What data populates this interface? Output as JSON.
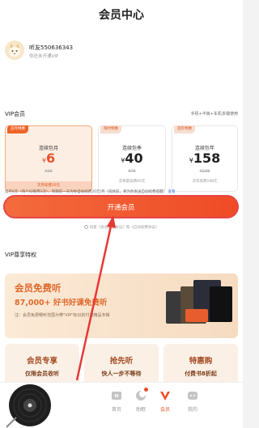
{
  "header": {
    "title": "会员中心"
  },
  "profile": {
    "username": "听友550636343",
    "status": "你还未开通VIP",
    "avatar_icon": "cat-avatar"
  },
  "vip": {
    "title": "VIP会员",
    "right_text": "手机+平板+车机多端使用",
    "cards": [
      {
        "tag": "首月特惠",
        "name": "连续包月",
        "yen": "¥",
        "price": "6",
        "original": "¥25",
        "note": "次月续费20元"
      },
      {
        "tag": "限时特惠",
        "name": "连续包季",
        "yen": "¥",
        "price": "40",
        "original": "¥75",
        "note": "次季度续费60元"
      },
      {
        "tag": "首年特惠",
        "name": "连续包年",
        "yen": "¥",
        "price": "158",
        "original": "¥238",
        "note": "次年续费198元"
      }
    ],
    "description": "首月6元（每个ID限用1次），到期前一天为你自动续费20元/月（扣款前，将为你发送自动续费提醒）",
    "description_link": "查看",
    "open_button": "开通会员",
    "agreement_prefix": "同意",
    "agreement_link1": "《会员服务协议》",
    "agreement_and": "和",
    "agreement_link2": "《自动续费协议》"
  },
  "privileges": {
    "title": "VIP尊享特权",
    "banner": {
      "title": "会员免费听",
      "subtitle": "87,000+ 好书好课免费听",
      "note": "注：会员免费畅听范围为带\"VIP\"标识的付费精品专辑"
    },
    "features": [
      {
        "title": "会员专享",
        "sub": "仅限会员收听"
      },
      {
        "title": "抢先听",
        "sub": "快人一步不等待"
      },
      {
        "title": "特惠购",
        "sub": "付费书8折起"
      }
    ]
  },
  "tabbar": {
    "items": [
      {
        "label": "首页",
        "icon": "home-icon",
        "active": false
      },
      {
        "label": "助眠",
        "icon": "sleep-icon",
        "active": false
      },
      {
        "label": "会员",
        "icon": "vip-icon",
        "active": true
      },
      {
        "label": "我的",
        "icon": "profile-icon",
        "active": false
      }
    ]
  },
  "colors": {
    "accent": "#ef4b26",
    "banner": "#f6dbc0",
    "feature_text": "#a34a22"
  }
}
